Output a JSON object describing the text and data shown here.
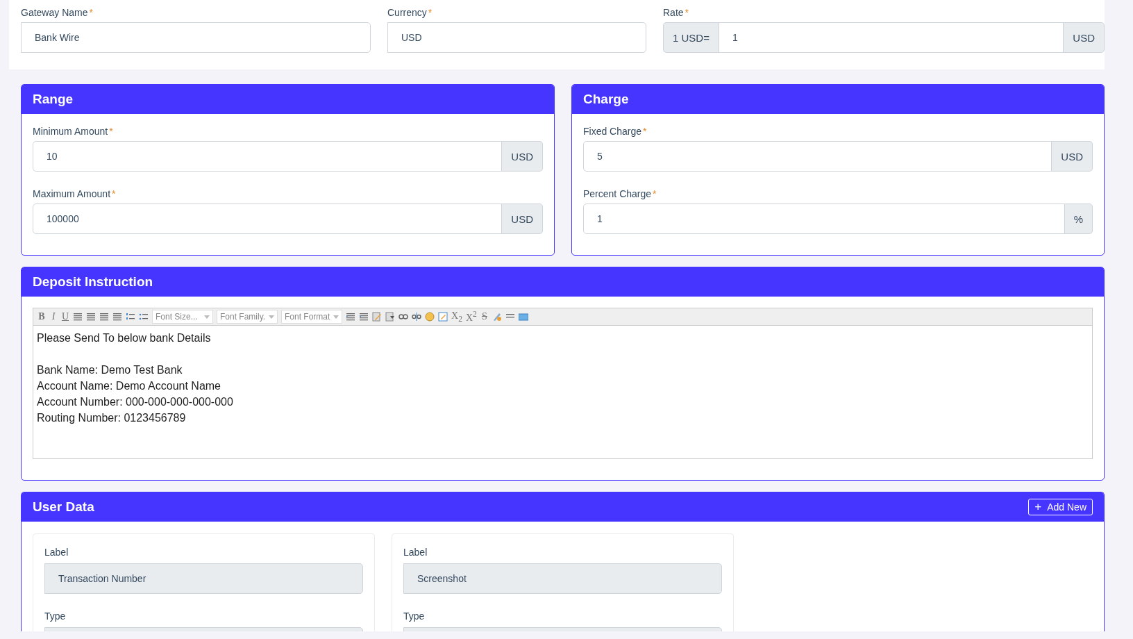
{
  "gateway": {
    "fields": [
      {
        "label": "Gateway Name",
        "mark": "*",
        "value": "Bank Wire"
      },
      {
        "label": "Currency",
        "mark": "*",
        "value": "USD"
      },
      {
        "label": "Rate",
        "mark": "*",
        "prefix": "1 USD=",
        "value": "1",
        "suffix": "USD"
      }
    ]
  },
  "range": {
    "title": "Range",
    "fields": [
      {
        "label": "Minimum Amount",
        "mark": "*",
        "value": "10",
        "suffix": "USD"
      },
      {
        "label": "Maximum Amount",
        "mark": "*",
        "value": "100000",
        "suffix": "USD"
      }
    ]
  },
  "charge": {
    "title": "Charge",
    "fields": [
      {
        "label": "Fixed Charge",
        "mark": "*",
        "value": "5",
        "suffix": "USD"
      },
      {
        "label": "Percent Charge",
        "mark": "*",
        "value": "1",
        "suffix": "%"
      }
    ]
  },
  "deposit_instruction": {
    "title": "Deposit Instruction",
    "toolbar": {
      "format_buttons": [
        "B",
        "I",
        "U"
      ],
      "selects": [
        "Font Size...",
        "Font Family.",
        "Font Format"
      ],
      "script_buttons": [
        "X$_{2}$",
        "X$^{2}$",
        "S"
      ]
    },
    "paragraphs": [
      [
        "Please Send To below bank Details"
      ],
      [
        "Bank Name: Demo Test Bank",
        "Account Name: Demo Account Name",
        "Account Number: 000-000-000-000-000",
        "Routing Number: 0123456789"
      ]
    ]
  },
  "user_data": {
    "title": "User Data",
    "add_button": {
      "icon": "+",
      "label": "Add New"
    },
    "items": [
      {
        "fields": [
          {
            "label": "Label",
            "value": "Transaction Number"
          },
          {
            "label": "Type"
          }
        ]
      },
      {
        "fields": [
          {
            "label": "Label",
            "value": "Screenshot"
          },
          {
            "label": "Type"
          }
        ]
      }
    ]
  }
}
